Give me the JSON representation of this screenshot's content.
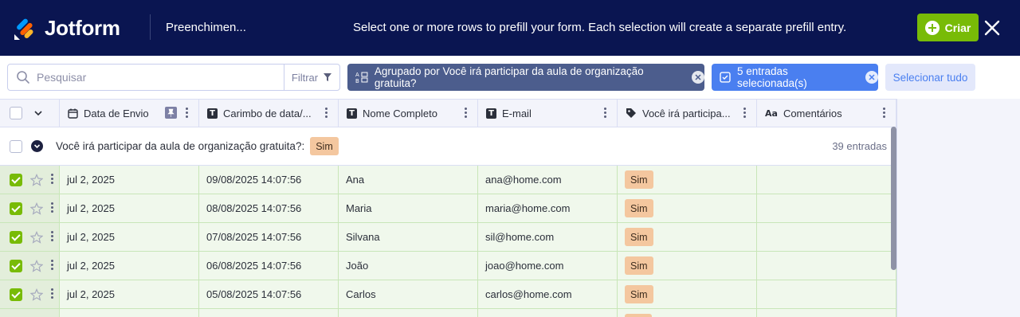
{
  "header": {
    "brand": "Jotform",
    "form_title": "Preenchimen...",
    "notice": "Select one or more rows to prefill your form. Each selection will create a separate prefill entry.",
    "create_label": "Criar"
  },
  "toolbar": {
    "search_placeholder": "Pesquisar",
    "filter_label": "Filtrar",
    "group_chip": "Agrupado por Você irá participar da aula de organização gratuita?",
    "selected_chip": "5 entradas selecionada(s)",
    "select_all_label": "Selecionar tudo"
  },
  "columns": [
    {
      "label": "Data de Envio",
      "icon": "calendar-icon"
    },
    {
      "label": "Carimbo de data/...",
      "icon": "text-icon"
    },
    {
      "label": "Nome Completo",
      "icon": "text-icon"
    },
    {
      "label": "E-mail",
      "icon": "text-icon"
    },
    {
      "label": "Você irá participa...",
      "icon": "tag-icon"
    },
    {
      "label": "Comentários",
      "icon": "aa-icon"
    }
  ],
  "group": {
    "label": "Você irá participar da aula de organização gratuita?:",
    "value": "Sim",
    "count": "39 entradas"
  },
  "rows": [
    {
      "date": "jul 2, 2025",
      "timestamp": "09/08/2025 14:07:56",
      "name": "Ana",
      "email": "ana@home.com",
      "answer": "Sim",
      "comment": ""
    },
    {
      "date": "jul 2, 2025",
      "timestamp": "08/08/2025 14:07:56",
      "name": "Maria",
      "email": "maria@home.com",
      "answer": "Sim",
      "comment": ""
    },
    {
      "date": "jul 2, 2025",
      "timestamp": "07/08/2025 14:07:56",
      "name": "Silvana",
      "email": "sil@home.com",
      "answer": "Sim",
      "comment": ""
    },
    {
      "date": "jul 2, 2025",
      "timestamp": "06/08/2025 14:07:56",
      "name": "João",
      "email": "joao@home.com",
      "answer": "Sim",
      "comment": ""
    },
    {
      "date": "jul 2, 2025",
      "timestamp": "05/08/2025 14:07:56",
      "name": "Carlos",
      "email": "carlos@home.com",
      "answer": "Sim",
      "comment": ""
    }
  ],
  "colors": {
    "header_bg": "#0a1551",
    "create_green": "#78bb07",
    "chip_group": "#4c5d8d",
    "chip_selected": "#4a7ff0",
    "badge": "#f4c79f",
    "selected_row": "#f0f8ec"
  }
}
